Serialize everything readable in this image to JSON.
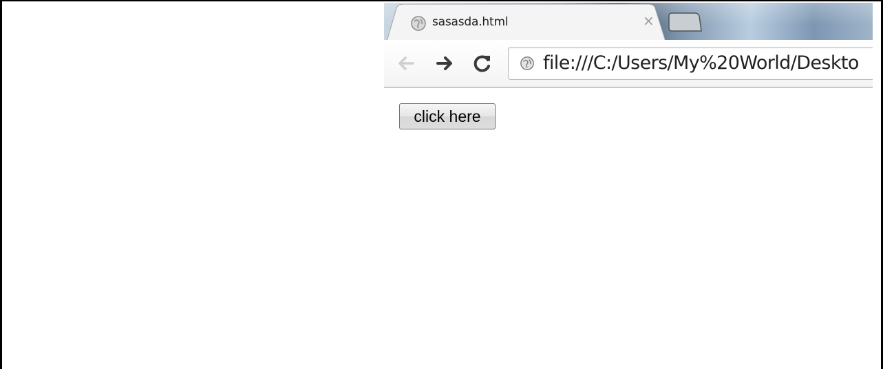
{
  "tab": {
    "title": "sasasda.html",
    "close_glyph": "×",
    "favicon": "globe-icon"
  },
  "toolbar": {
    "back_icon": "back-arrow-icon",
    "forward_icon": "forward-arrow-icon",
    "reload_icon": "reload-icon",
    "address": "file:///C:/Users/My%20World/Deskto"
  },
  "page": {
    "button_label": "click here"
  },
  "colors": {
    "chrome_frame": "#3e4a58",
    "toolbar": "#f4f4f4",
    "content": "#ffffff"
  }
}
